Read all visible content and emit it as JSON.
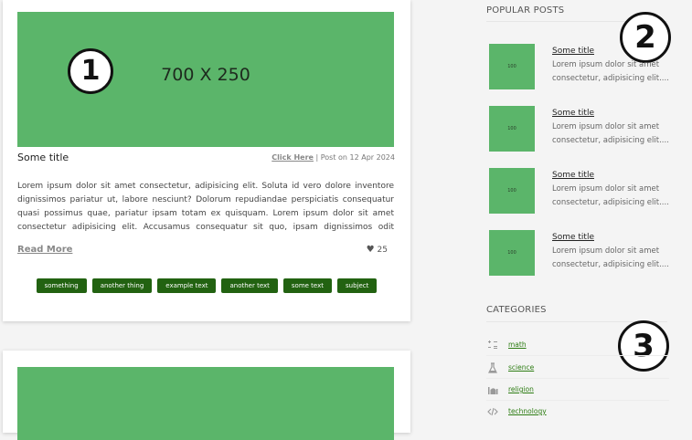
{
  "post": {
    "hero_text": "700 X 250",
    "annotation": "1",
    "title": "Some title",
    "click_here": "Click Here",
    "meta_suffix": " | Post on 12 Apr 2024",
    "excerpt": "Lorem ipsum dolor sit amet consectetur, adipisicing elit. Soluta id vero dolore inventore dignissimos pariatur ut, labore nesciunt? Dolorum repudiandae perspiciatis consequatur quasi possimus quae, pariatur ipsam totam ex quisquam. Lorem ipsum dolor sit amet consectetur adipisicing elit. Accusamus consequatur sit quo, ipsam dignissimos odit molestiae voluptas quis",
    "read_more": "Read More",
    "likes": "25",
    "tags": [
      "something",
      "another thing",
      "example text",
      "another text",
      "some text",
      "subject"
    ]
  },
  "popular_posts": {
    "heading": "POPULAR POSTS",
    "annotation": "2",
    "thumb_text": "100",
    "items": [
      {
        "title": "Some title",
        "line1": "Lorem ipsum dolor sit amet",
        "line2": "consectetur, adipisicing elit...."
      },
      {
        "title": "Some title",
        "line1": "Lorem ipsum dolor sit amet",
        "line2": "consectetur, adipisicing elit...."
      },
      {
        "title": "Some title",
        "line1": "Lorem ipsum dolor sit amet",
        "line2": "consectetur, adipisicing elit...."
      },
      {
        "title": "Some title",
        "line1": "Lorem ipsum dolor sit amet",
        "line2": "consectetur, adipisicing elit...."
      }
    ]
  },
  "categories": {
    "heading": "CATEGORIES",
    "annotation": "3",
    "items": [
      {
        "label": "math",
        "icon": "math-icon"
      },
      {
        "label": "science",
        "icon": "flask-icon"
      },
      {
        "label": "religion",
        "icon": "mosque-icon"
      },
      {
        "label": "technology",
        "icon": "code-icon"
      }
    ]
  },
  "colors": {
    "accent_green": "#5bb56a",
    "tag_bg": "#226211",
    "link_green": "#2e7d14"
  }
}
